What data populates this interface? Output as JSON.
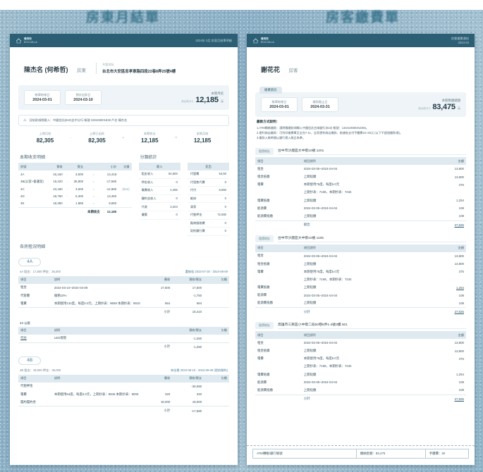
{
  "ghost_titles": {
    "left": "房東月結單",
    "right": "房客繳費單"
  },
  "landlord_doc": {
    "header": {
      "brand_top": "覺明物",
      "brand_bottom": "ECO-VILLA",
      "right_line": "2024年 3月 房東月結單明細"
    },
    "person": {
      "name": "陳杰名 (何希哲)",
      "role": "房東",
      "addr_label": "共管地址",
      "addr_value": "台北市大安區忠孝東路四段22巷8弄25號4樓"
    },
    "summary": {
      "chips": [
        {
          "label": "帳單結帳日",
          "value": "2024-03-01"
        },
        {
          "label": "預計出款日",
          "value": "2024-03-10"
        }
      ],
      "amount_label": "本期月結",
      "amount_prefix": "新台幣(NT)",
      "amount_value": "12,185",
      "amount_unit": "元"
    },
    "notice": "月結款項將匯入：中國信託(822)台中分行 帳號 330408001838 戶名 陳杰名",
    "formula": [
      {
        "label": "上期月結",
        "value": "82,305"
      },
      {
        "label": "上期已出款",
        "value": "82,305"
      },
      {
        "label": "本期收支",
        "value": "12,185"
      },
      {
        "label": "本期月結",
        "value": "12,185"
      }
    ],
    "formula_ops": [
      "-",
      "+",
      "="
    ],
    "detail": {
      "title": "本期收支明細",
      "headers": [
        "房號",
        "實收",
        "",
        "實支",
        "",
        "小計",
        "欠繳"
      ],
      "rows": [
        {
          "room": "4A",
          "income": "16,160",
          "expense": "3,000",
          "subtotal": "13,418",
          "owe": ""
        },
        {
          "room": "4B(公室+會議室)",
          "income": "19,220",
          "expense": "36,800",
          "subtotal": "-17,580",
          "owe": ""
        },
        {
          "room": "4C",
          "income": "23,180",
          "expense": "3,000",
          "subtotal": "-12,980",
          "owe": "(822)"
        },
        {
          "room": "4D",
          "income": "18,750",
          "expense": "5,300",
          "subtotal": "13,450",
          "owe": ""
        },
        {
          "room": "4E",
          "income": "18,350",
          "expense": "1,855",
          "subtotal": "9,550",
          "owe": ""
        }
      ],
      "total_label": "本期收支",
      "total_value": "12,185"
    },
    "stats": {
      "title": "分類統計",
      "income_head": "收入",
      "expense_head": "支出",
      "income_rows": [
        {
          "label": "租金收入",
          "value": "54,500"
        },
        {
          "label": "押金收入",
          "value": "0"
        },
        {
          "label": "電費收入",
          "value": "4,465"
        },
        {
          "label": "履約金收入",
          "value": "0"
        },
        {
          "label": "代收",
          "value": "3,204"
        },
        {
          "label": "優惠",
          "value": "0"
        }
      ],
      "expense_rows": [
        {
          "label": "代管費",
          "value": "54,50"
        },
        {
          "label": "代租售代費",
          "value": "0"
        },
        {
          "label": "代付",
          "value": "6,550"
        },
        {
          "label": "維修",
          "value": "0"
        },
        {
          "label": "清潔",
          "value": "0"
        },
        {
          "label": "代墊押金",
          "value": "72,080"
        },
        {
          "label": "廠商服務費",
          "value": "0"
        },
        {
          "label": "契約履行費",
          "value": "0"
        }
      ]
    },
    "rooms_title": "各房租況明細",
    "rooms": [
      {
        "badge": "4A",
        "meta_left": "4A  租金：17,500   押金：35,000",
        "meta_right": "蕭無佑 2023-07-20 - 2024-08-09",
        "headers": [
          "項目",
          "說明",
          "應收",
          "實收/實支",
          "欠繳"
        ],
        "rows": [
          {
            "item": "租金",
            "desc": "2024-03-10~2024-04-09",
            "due": "17,500",
            "paid": "17,500",
            "owe": "",
            "link": false
          },
          {
            "item": "代管費",
            "desc": "服務10%",
            "due": "",
            "paid": "-1,750",
            "owe": "",
            "link": false
          },
          {
            "item": "電費",
            "desc": "本期使用132度，每度5.0元，上期抄表：8659 本期抄表：8810",
            "due": "664",
            "paid": "664",
            "owe": "",
            "link": false
          }
        ],
        "subtotal_label": "小計",
        "subtotal_value": "16,410",
        "sub_section": {
          "label": "4A 公用",
          "headers": [
            "項目",
            "說明",
            "實收/實支",
            "欠繳"
          ],
          "rows": [
            {
              "item": "代付",
              "desc": "LED燈管",
              "paid": "-1,250",
              "owe": "",
              "link": true
            }
          ],
          "subtotal_label": "小計",
          "subtotal_value": "-1,250"
        }
      },
      {
        "badge": "4B",
        "meta_left": "4B  租金：18,000   押金：36,000",
        "meta_right": "林佳慧 2022-08-16 - 2024-09-09 (提前解約)",
        "headers": [
          "項目",
          "說明",
          "應收",
          "實收/實支",
          "欠繳"
        ],
        "rows": [
          {
            "item": "代墊押金",
            "desc": "",
            "due": "",
            "paid": "-36,080",
            "owe": "",
            "link": false
          },
          {
            "item": "電費",
            "desc": "本期使用64度，每度5.0元，上期抄表：8945 本期抄表：9005",
            "due": "320",
            "paid": "320",
            "owe": "",
            "link": false
          },
          {
            "item": "履約履約金",
            "desc": "",
            "due": "18,000",
            "paid": "18,000",
            "owe": "",
            "link": false
          }
        ],
        "subtotal_label": "小計",
        "subtotal_value": "-17,580"
      }
    ]
  },
  "tenant_doc": {
    "header": {
      "brand_top": "覺明物",
      "brand_bottom": "ECO-VILLA",
      "right_line1": "房客繳費通知",
      "right_line2": "2024-03"
    },
    "person": {
      "name": "謝花花",
      "role": "房客"
    },
    "summary": {
      "tab": "繳費資訊",
      "chips": [
        {
          "label": "帳單結帳日",
          "value": "2024-03-01"
        },
        {
          "label": "繳款截止日",
          "value": "2024-03-31"
        }
      ],
      "amount_label": "本期應繳總額",
      "amount_prefix": "新台幣(NT)",
      "amount_value": "83,475",
      "amount_unit": "元"
    },
    "notes": {
      "title": "繳款方式說明：",
      "lines": [
        "1.ATM轉帳繳款：請將應繳款項轉入中國信託台灣銀行(822) 帳號：133410680452356。",
        "2.便利商店繳款：可列印繳費單至全台7-11、全家便利商店繳款，依據各支付手續費15~25元 (以下不超過繳款項)。",
        "3.繳款入帳時間以銀行實入帳日為準。"
      ]
    },
    "properties": [
      {
        "tag": "租賃地址",
        "address": "台中市沙鹿區大中街10號 1201",
        "headers": [
          "項目",
          "項目說明",
          "金額"
        ],
        "rows": [
          {
            "item": "租金",
            "desc": "2024-03-05~2024-04-04",
            "amount": "13,800",
            "link": false
          },
          {
            "item": "租金抵繳",
            "desc": "上期短繳",
            "amount": "13,800",
            "link": false
          },
          {
            "item": "電費",
            "desc": "本期使用75度，每度5.0元",
            "amount": "375",
            "link": false
          },
          {
            "item": "",
            "desc": "上期抄表：7159，本期抄表：7234",
            "amount": "",
            "link": false
          },
          {
            "item": "電費抵繳",
            "desc": "上期短繳",
            "amount": "1,254",
            "link": false
          },
          {
            "item": "能源費",
            "desc": "2024-03-05~2024-04-04",
            "amount": "108",
            "link": false
          },
          {
            "item": "能源費抵繳",
            "desc": "上期短繳",
            "amount": "108",
            "link": false
          }
        ],
        "total_label": "組合",
        "total_value": "27,825"
      },
      {
        "tag": "租賃地址",
        "address": "台中市沙鹿區大中街10號 1105",
        "headers": [
          "項目",
          "項目說明",
          "金額"
        ],
        "rows": [
          {
            "item": "租金",
            "desc": "2024-03-05~2024-04-04",
            "amount": "13,800",
            "link": false
          },
          {
            "item": "租金抵繳",
            "desc": "上期短繳",
            "amount": "13,800",
            "link": false
          },
          {
            "item": "電費",
            "desc": "本期使用75度，每度5.0元",
            "amount": "375",
            "link": false
          },
          {
            "item": "",
            "desc": "上期抄表：7159，本期抄表：7234",
            "amount": "",
            "link": false
          },
          {
            "item": "電費抵繳",
            "desc": "上期短繳",
            "amount": "1,254",
            "link": true
          },
          {
            "item": "能源費",
            "desc": "2024-03-05~2024-04-04",
            "amount": "108",
            "link": false
          },
          {
            "item": "能源費抵繳",
            "desc": "上期短繳",
            "amount": "108",
            "link": false
          }
        ],
        "total_label": "小計",
        "total_value": "27,825"
      },
      {
        "tag": "租賃地址",
        "address": "高雄市三民區小中街二段50巷6弄1-2號3樓 501",
        "headers": [
          "項目",
          "項目說明",
          "金額"
        ],
        "rows": [
          {
            "item": "租金",
            "desc": "2024-03-05~2024-04-04",
            "amount": "13,800",
            "link": false
          },
          {
            "item": "租金抵繳",
            "desc": "上期短繳",
            "amount": "13,800",
            "link": false
          },
          {
            "item": "電費",
            "desc": "本期使用75度，每度5.0元",
            "amount": "375",
            "link": false
          },
          {
            "item": "",
            "desc": "上期抄表：7159，本期抄表：7234",
            "amount": "",
            "link": false
          },
          {
            "item": "電費抵繳",
            "desc": "上期短繳",
            "amount": "1,254",
            "link": false
          },
          {
            "item": "能源費",
            "desc": "2024-03-05~2024-04-04",
            "amount": "108",
            "link": false
          },
          {
            "item": "能源費抵繳",
            "desc": "上期短繳",
            "amount": "108",
            "link": false
          }
        ],
        "total_label": "小計",
        "total_value": "27,825"
      }
    ],
    "voucher": {
      "cell_bank": "ATM轉帳/銀行帳號",
      "cell_amount": "繳納金額：83,475",
      "cell_fee": "手續費：20"
    }
  }
}
